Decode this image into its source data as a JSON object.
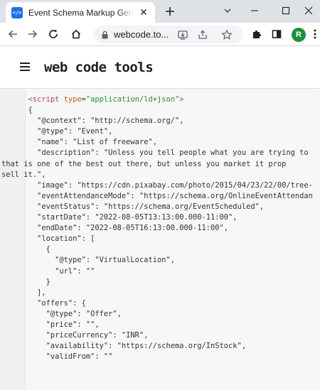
{
  "browser": {
    "tab": {
      "title": "Event Schema Markup Generator",
      "favicon": "</>"
    },
    "new_tab_icon": "plus-icon",
    "window_controls": [
      "chevron-down-icon",
      "minimize-icon",
      "maximize-icon",
      "close-icon"
    ],
    "toolbar": {
      "url": "webcode.to...",
      "avatar_letter": "R",
      "avatar_color": "#1e8e3e"
    }
  },
  "site": {
    "logo": "web code tools"
  },
  "code": {
    "lines": [
      {
        "indent": 6,
        "text": "<script type=\"application/ld+json\">"
      },
      {
        "indent": 6,
        "text": "{"
      },
      {
        "indent": 6,
        "text": "  \"@context\": \"http://schema.org/\","
      },
      {
        "indent": 6,
        "text": "  \"@type\": \"Event\","
      },
      {
        "indent": 6,
        "text": "  \"name\": \"List of freeware\","
      },
      {
        "indent": 6,
        "text": "  \"description\": \"Unless you tell people what you are trying to"
      },
      {
        "indent": 0,
        "text": "that is one of the best out there, but unless you market it prop"
      },
      {
        "indent": 0,
        "text": "sell it.\","
      },
      {
        "indent": 6,
        "text": "  \"image\": \"https://cdn.pixabay.com/photo/2015/04/23/22/00/tree-"
      },
      {
        "indent": 6,
        "text": "  \"eventAttendanceMode\": \"https://schema.org/OnlineEventAttendan"
      },
      {
        "indent": 6,
        "text": "  \"eventStatus\": \"https://schema.org/EventScheduled\","
      },
      {
        "indent": 6,
        "text": "  \"startDate\": \"2022-08-05T13:13:00.000-11:00\","
      },
      {
        "indent": 6,
        "text": "  \"endDate\": \"2022-08-05T16:13:00.000-11:00\","
      },
      {
        "indent": 6,
        "text": "  \"location\": ["
      },
      {
        "indent": 6,
        "text": "    {"
      },
      {
        "indent": 6,
        "text": "      \"@type\": \"VirtualLocation\","
      },
      {
        "indent": 6,
        "text": "      \"url\": \"\""
      },
      {
        "indent": 6,
        "text": "    }"
      },
      {
        "indent": 6,
        "text": "  ],"
      },
      {
        "indent": 6,
        "text": "  \"offers\": {"
      },
      {
        "indent": 6,
        "text": "    \"@type\": \"Offer\","
      },
      {
        "indent": 6,
        "text": "    \"price\": \"\","
      },
      {
        "indent": 6,
        "text": "    \"priceCurrency\": \"INR\","
      },
      {
        "indent": 6,
        "text": "    \"availability\": \"https://schema.org/InStock\","
      },
      {
        "indent": 6,
        "text": "    \"validFrom\": \"\""
      }
    ]
  }
}
